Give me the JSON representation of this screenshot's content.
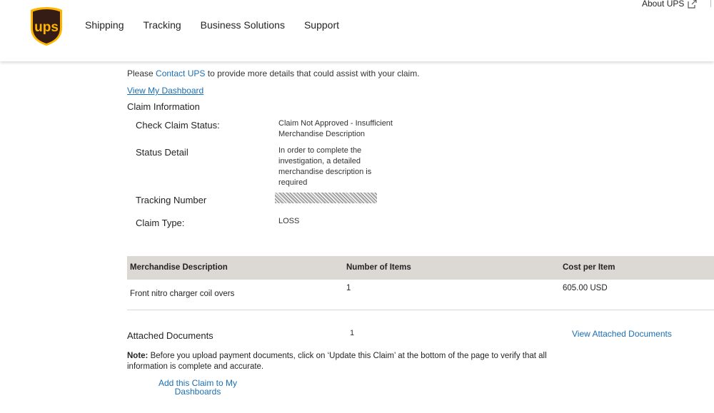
{
  "header": {
    "logo_text": "ups",
    "nav": [
      "Shipping",
      "Tracking",
      "Business Solutions",
      "Support"
    ],
    "about_label": "About UPS",
    "brand_colors": {
      "shield": "#351C15",
      "gold": "#FFB500"
    }
  },
  "intro": {
    "partial_text": "",
    "contact_prefix": "Please ",
    "contact_link": "Contact UPS",
    "contact_suffix": " to provide more details that could assist with your claim.",
    "dashboard_link": "View My Dashboard"
  },
  "claim_info": {
    "title": "Claim Information",
    "fields": [
      {
        "label": "Check Claim Status:",
        "value": "Claim Not Approved - Insufficient Merchandise Description"
      },
      {
        "label": "Status Detail",
        "value": "In order to complete the investigation, a detailed merchandise description is required"
      },
      {
        "label": "Tracking Number",
        "value": ""
      },
      {
        "label": "Claim Type:",
        "value": "LOSS"
      }
    ]
  },
  "merch_table": {
    "headers": [
      "Merchandise Description",
      "Number of Items",
      "Cost per Item"
    ],
    "rows": [
      [
        "Front nitro charger coil overs",
        "1",
        "605.00 USD"
      ]
    ]
  },
  "attached": {
    "label": "Attached Documents",
    "count": "1",
    "link": "View Attached Documents"
  },
  "note": {
    "prefix": "Note:",
    "text": " Before you upload payment documents, click on ‘Update this Claim’ at the bottom of the page to verify that all information is complete and accurate."
  },
  "actions": {
    "add_claim_line1": "Add this Claim to My",
    "add_claim_line2": "Dashboards"
  },
  "colors": {
    "link": "#1a6fb5",
    "table_header_bg": "#dcd8d3"
  }
}
